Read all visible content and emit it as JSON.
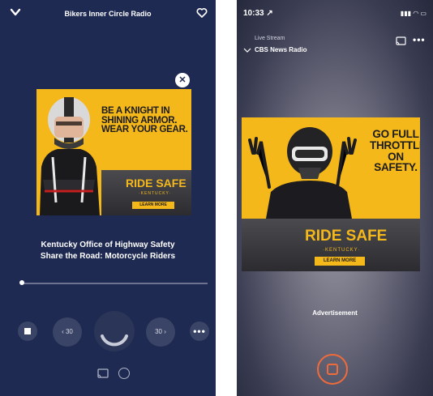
{
  "left_player": {
    "station_title": "Bikers Inner Circle Radio",
    "ad": {
      "headline_lines": [
        "BE A KNIGHT IN",
        "SHINING ARMOR.",
        "WEAR YOUR GEAR."
      ],
      "brand": "RIDE SAFE",
      "brand_sub": "·KENTUCKY·",
      "cta": "LEARN MORE",
      "close_symbol": "✕"
    },
    "caption_line1": "Kentucky Office of Highway Safety",
    "caption_line2": "Share the Road: Motorcycle Riders",
    "progress_fraction": 0.0,
    "controls": {
      "rewind_label": "‹ 30",
      "forward_label": "30 ›",
      "more_label": "•••"
    },
    "icons": [
      "chevron-down-icon",
      "heart-icon",
      "close-icon",
      "stop-icon",
      "more-icon",
      "cast-icon",
      "airplay-icon"
    ],
    "colors": {
      "background": "#1f2a52",
      "ad_yellow": "#f5b81b"
    }
  },
  "right_player": {
    "status_time": "10:33 ↗",
    "status_icons": "▮▮▮ ◠ ▭",
    "live_label": "Live Stream",
    "station_name": "CBS News Radio",
    "more_label": "•••",
    "ad": {
      "headline_lines": [
        "GO FULL",
        "THROTTLE",
        "ON",
        "SAFETY."
      ],
      "brand": "RIDE SAFE",
      "brand_sub": "·KENTUCKY·",
      "cta": "LEARN MORE"
    },
    "ad_label": "Advertisement",
    "icons": [
      "chevron-down-icon",
      "cast-icon",
      "more-icon",
      "stop-icon"
    ],
    "colors": {
      "stop_accent": "#f06a3c",
      "ad_yellow": "#f5b81b"
    }
  }
}
